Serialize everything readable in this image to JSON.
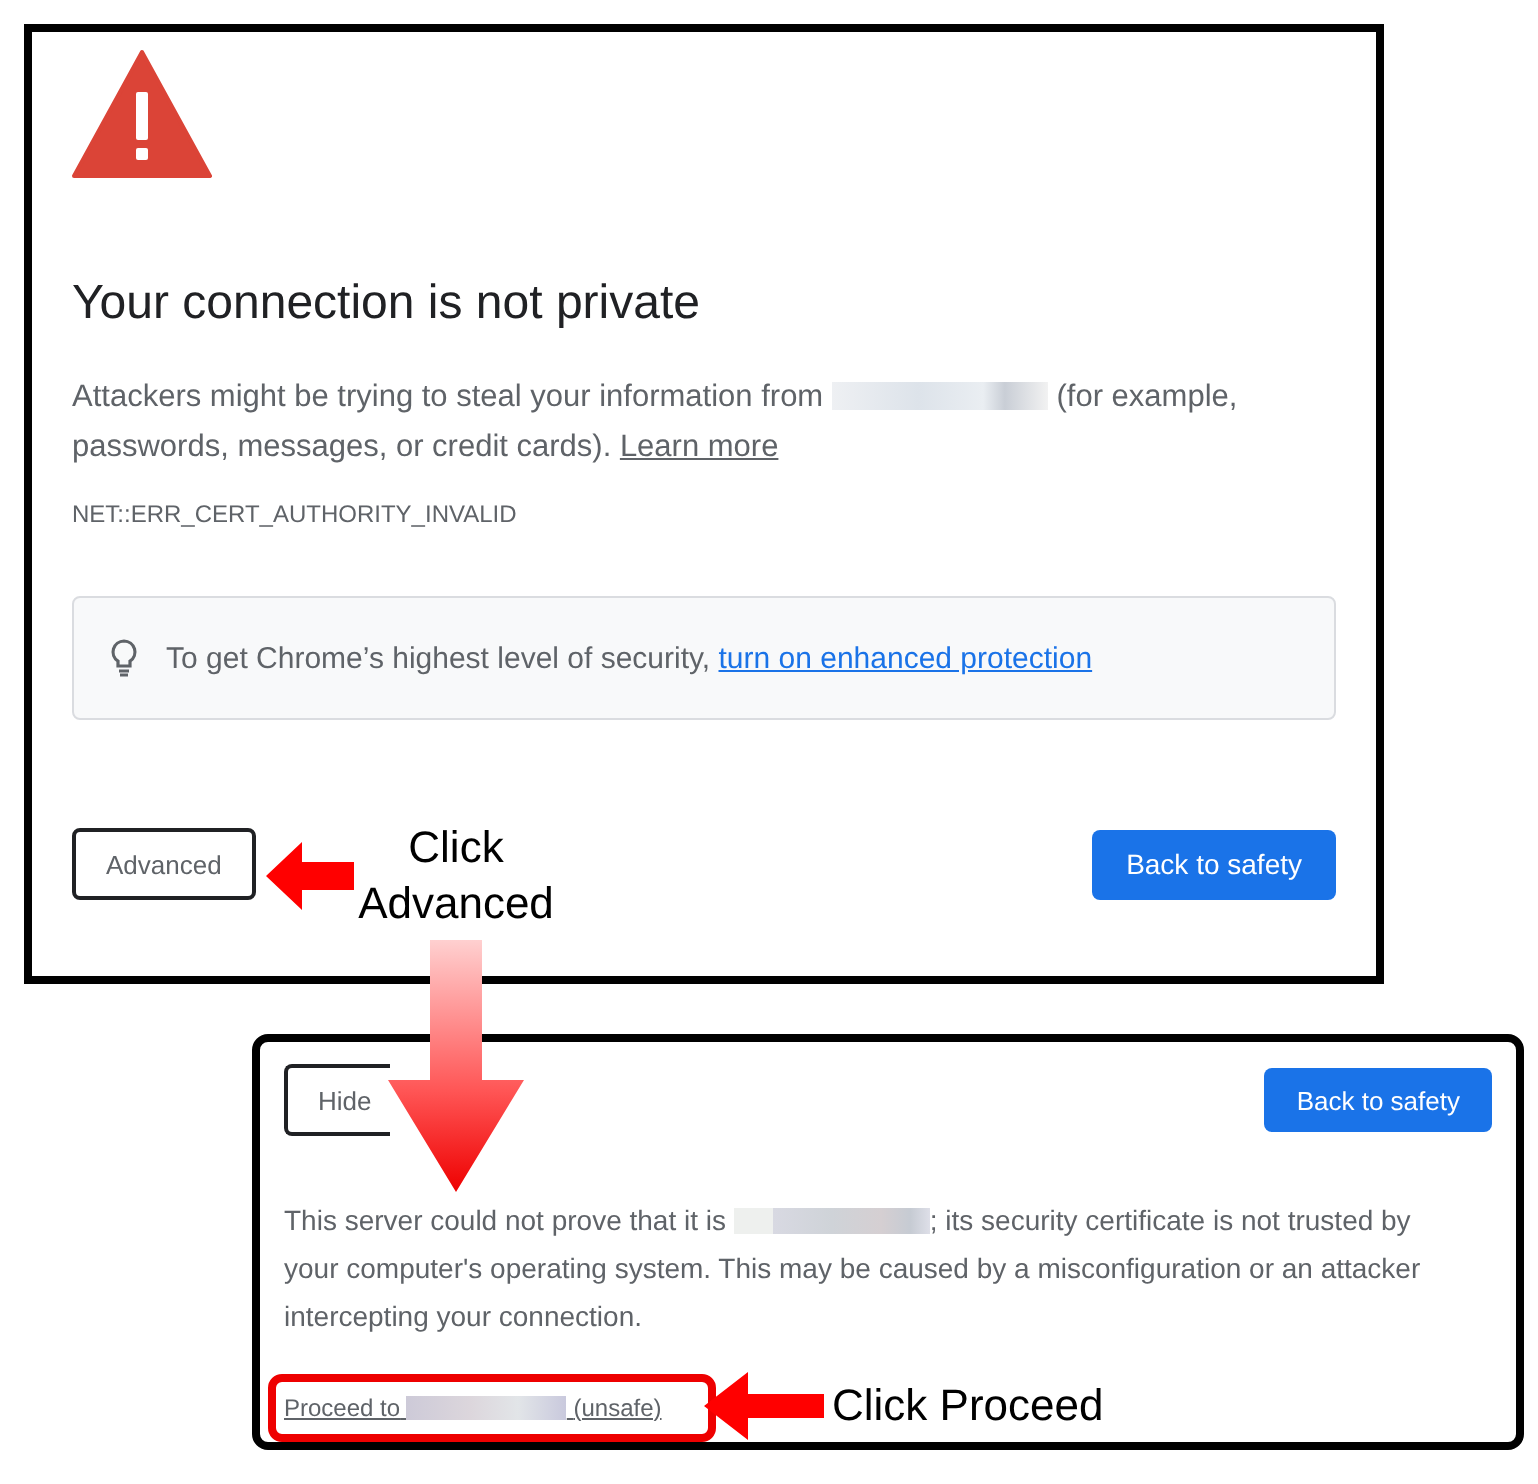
{
  "warning_page": {
    "title": "Your connection is not private",
    "description": {
      "before": "Attackers might be trying to steal your information from",
      "after": "(for example, passwords, messages, or credit cards).",
      "link": "Learn more"
    },
    "error_code": "NET::ERR_CERT_AUTHORITY_INVALID",
    "tip": {
      "text": "To get Chrome’s highest level of security,",
      "link": "turn on enhanced protection"
    },
    "buttons": [
      {
        "label": "Advanced",
        "kind": "secondary"
      },
      {
        "label": "Back to safety",
        "kind": "primary"
      }
    ]
  },
  "advanced_panel": {
    "buttons": [
      {
        "label": "Hide",
        "kind": "secondary"
      },
      {
        "label": "Back to safety",
        "kind": "primary"
      }
    ],
    "explanation": {
      "before": "This server could not prove that it is",
      "after": "; its security certificate is not trusted by your computer's operating system. This may be caused by a misconfiguration or an attacker intercepting your connection."
    },
    "proceed_link": {
      "before": "Proceed to",
      "after": "(unsafe)"
    }
  },
  "annotations": [
    {
      "text": "Click Advanced"
    },
    {
      "text": "Click Proceed"
    }
  ]
}
